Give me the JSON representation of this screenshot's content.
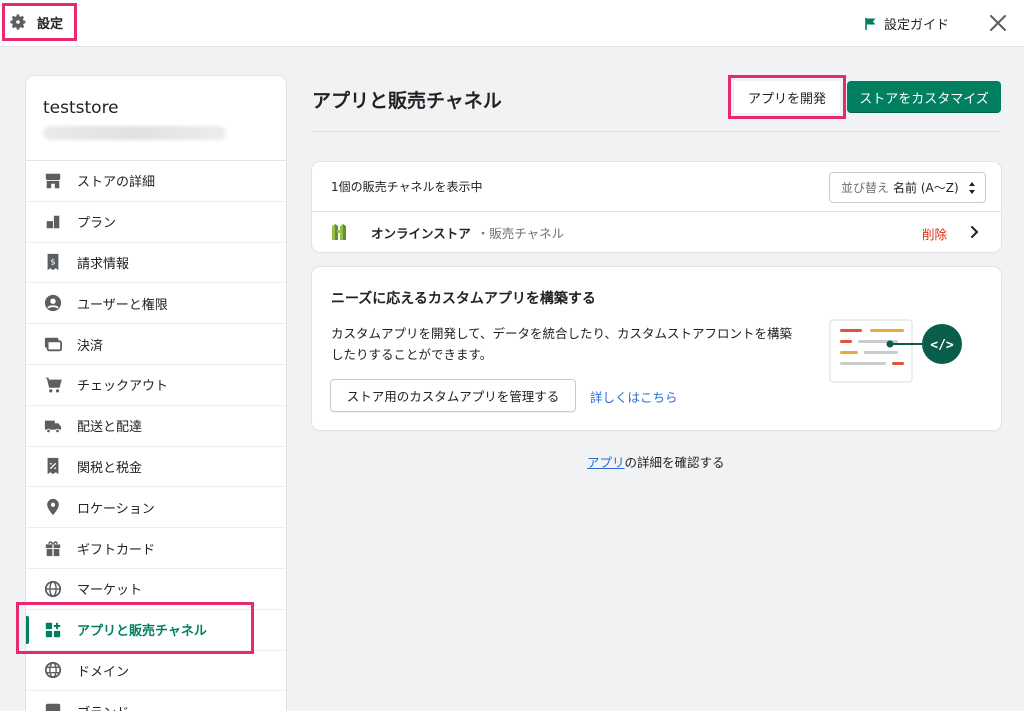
{
  "topbar": {
    "title": "設定",
    "guide_label": "設定ガイド",
    "icons": [
      "gear-icon",
      "flag-icon",
      "close-icon"
    ]
  },
  "sidebar": {
    "store_name": "teststore",
    "items": [
      {
        "label": "ストアの詳細",
        "icon": "store-icon"
      },
      {
        "label": "プラン",
        "icon": "plan-icon"
      },
      {
        "label": "請求情報",
        "icon": "billing-icon"
      },
      {
        "label": "ユーザーと権限",
        "icon": "user-icon"
      },
      {
        "label": "決済",
        "icon": "payment-icon"
      },
      {
        "label": "チェックアウト",
        "icon": "cart-icon"
      },
      {
        "label": "配送と配達",
        "icon": "truck-icon"
      },
      {
        "label": "関税と税金",
        "icon": "tax-icon"
      },
      {
        "label": "ロケーション",
        "icon": "location-icon"
      },
      {
        "label": "ギフトカード",
        "icon": "gift-icon"
      },
      {
        "label": "マーケット",
        "icon": "globe-icon"
      },
      {
        "label": "アプリと販売チャネル",
        "icon": "apps-icon",
        "active": true
      },
      {
        "label": "ドメイン",
        "icon": "domain-icon"
      },
      {
        "label": "ブランド",
        "icon": "brand-icon"
      }
    ]
  },
  "main": {
    "title": "アプリと販売チャネル",
    "develop_button": "アプリを開発",
    "customize_button": "ストアをカスタマイズ",
    "channels": {
      "count_text": "1個の販売チャネルを表示中",
      "sort_prefix": "並び替え",
      "sort_value": "名前 (A〜Z)",
      "channel_name": "オンラインストア",
      "channel_sub": "・販売チャネル",
      "delete_label": "削除"
    },
    "custom_app": {
      "heading": "ニーズに応えるカスタムアプリを構築する",
      "description": "カスタムアプリを開発して、データを統合したり、カスタムストアフロントを構築したりすることができます。",
      "manage_button": "ストア用のカスタムアプリを管理する",
      "learn_more": "詳しくはこちら"
    },
    "footer": {
      "link_text": "アプリ",
      "rest_text": "の詳細を確認する"
    }
  },
  "colors": {
    "primary": "#008060",
    "highlight": "#e8296f",
    "link": "#2c6ecb",
    "danger": "#d72c0d"
  }
}
